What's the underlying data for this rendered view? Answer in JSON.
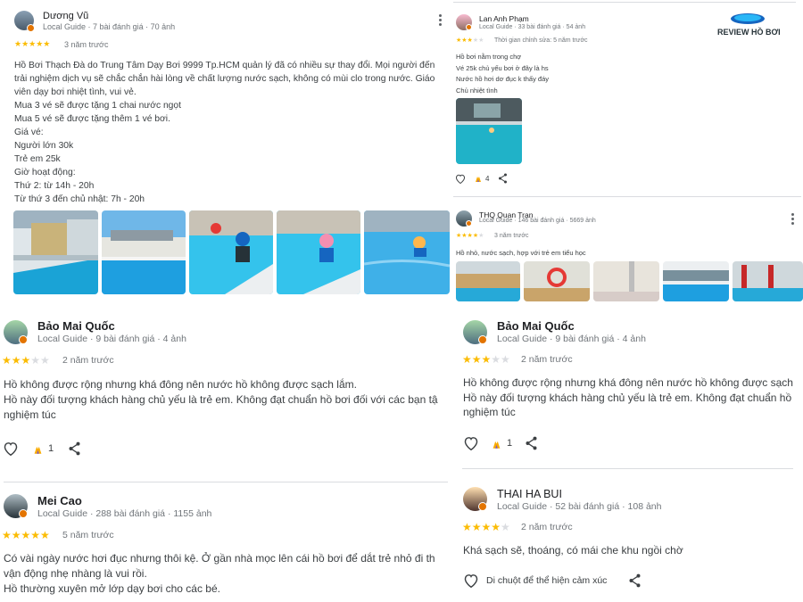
{
  "review1": {
    "name": "Dương Vũ",
    "meta": "Local Guide · 7 bài đánh giá · 70 ảnh",
    "rating": 5,
    "time": "3 năm trước",
    "text": "Hồ Bơi Thạch Đà do Trung Tâm Dạy Bơi 9999 Tp.HCM quản lý đã có nhiều sự thay đổi. Mọi người đến\ntrải nghiệm dịch vụ sẽ chắc chắn hài lòng về chất lượng nước sạch, không có mùi clo trong nước. Giáo\nviên dạy bơi nhiệt tình, vui vẻ.\nMua 3 vé sẽ được tặng 1 chai nước ngọt\nMua 5 vé sẽ được tặng thêm 1 vé bơi.\nGiá vé:\nNgười lớn 30k\nTrẻ em 25k\nGiờ hoạt động:\nThứ 2: từ 14h - 20h\nTừ thứ 3 đến chủ nhật: 7h - 20h"
  },
  "review2": {
    "name": "Lan Anh Phạm",
    "meta": "Local Guide · 33 bài đánh giá · 54 ảnh",
    "rating": 3,
    "time": "Thời gian chỉnh sửa: 5 năm trước",
    "text": "Hồ bơi nằm trong chợ\nVé 25k chủ yếu bơi ở đây là hs\nNước hồ hơi dơ đục k thấy đáy\nChủ nhiệt tình",
    "likes": "4"
  },
  "logo": {
    "text": "REVIEW HỒ BƠI"
  },
  "review3": {
    "name": "THQ Quan Tran",
    "meta": "Local Guide · 146 bài đánh giá · 5669 ảnh",
    "rating": 4,
    "time": "3 năm trước",
    "text": "Hồ nhỏ, nước sạch, hợp với trẻ em tiểu học"
  },
  "review4": {
    "name": "Bảo Mai Quốc",
    "meta": "Local Guide · 9 bài đánh giá · 4 ảnh",
    "rating": 3,
    "time": "2 năm trước",
    "text_left": "Hồ không được rộng nhưng khá đông nên nước hồ không được sạch lắm.\nHồ này đối tượng khách hàng chủ yếu là trẻ em. Không đạt chuẩn hồ bơi đối với các bạn tậ\nnghiệm túc",
    "text_right": "Hồ không được rộng nhưng khá đông nên nước hồ không được sạch\nHồ này đối tượng khách hàng chủ yếu là trẻ em. Không đạt chuẩn hồ\nnghiệm túc",
    "likes": "1"
  },
  "review5": {
    "name": "Mei Cao",
    "meta": "Local Guide · 288 bài đánh giá · 1155 ảnh",
    "rating": 5,
    "time": "5 năm trước",
    "text": "Có vài ngày nước hơi đục nhưng thôi kệ. Ở gần nhà mọc lên cái hồ bơi để dắt trẻ nhỏ đi th\nvận động nhẹ nhàng là vui rồi.\nHồ thường xuyên mở lớp dạy bơi cho các bé."
  },
  "review6": {
    "name": "THAI HA BUI",
    "meta": "Local Guide · 52 bài đánh giá · 108 ảnh",
    "rating": 4,
    "time": "2 năm trước",
    "text": "Khá sạch sẽ, thoáng, có mái che khu ngồi chờ",
    "react_hint": "Di chuột để thể hiện cảm xúc"
  },
  "colors": {
    "star": "#fbbc04",
    "star_off": "#dadce0",
    "badge": "#e37400",
    "pool": "#1aa3d6"
  },
  "icons": [
    "heart-icon",
    "clap-icon",
    "share-icon",
    "more-vert-icon",
    "local-guide-badge-icon"
  ]
}
